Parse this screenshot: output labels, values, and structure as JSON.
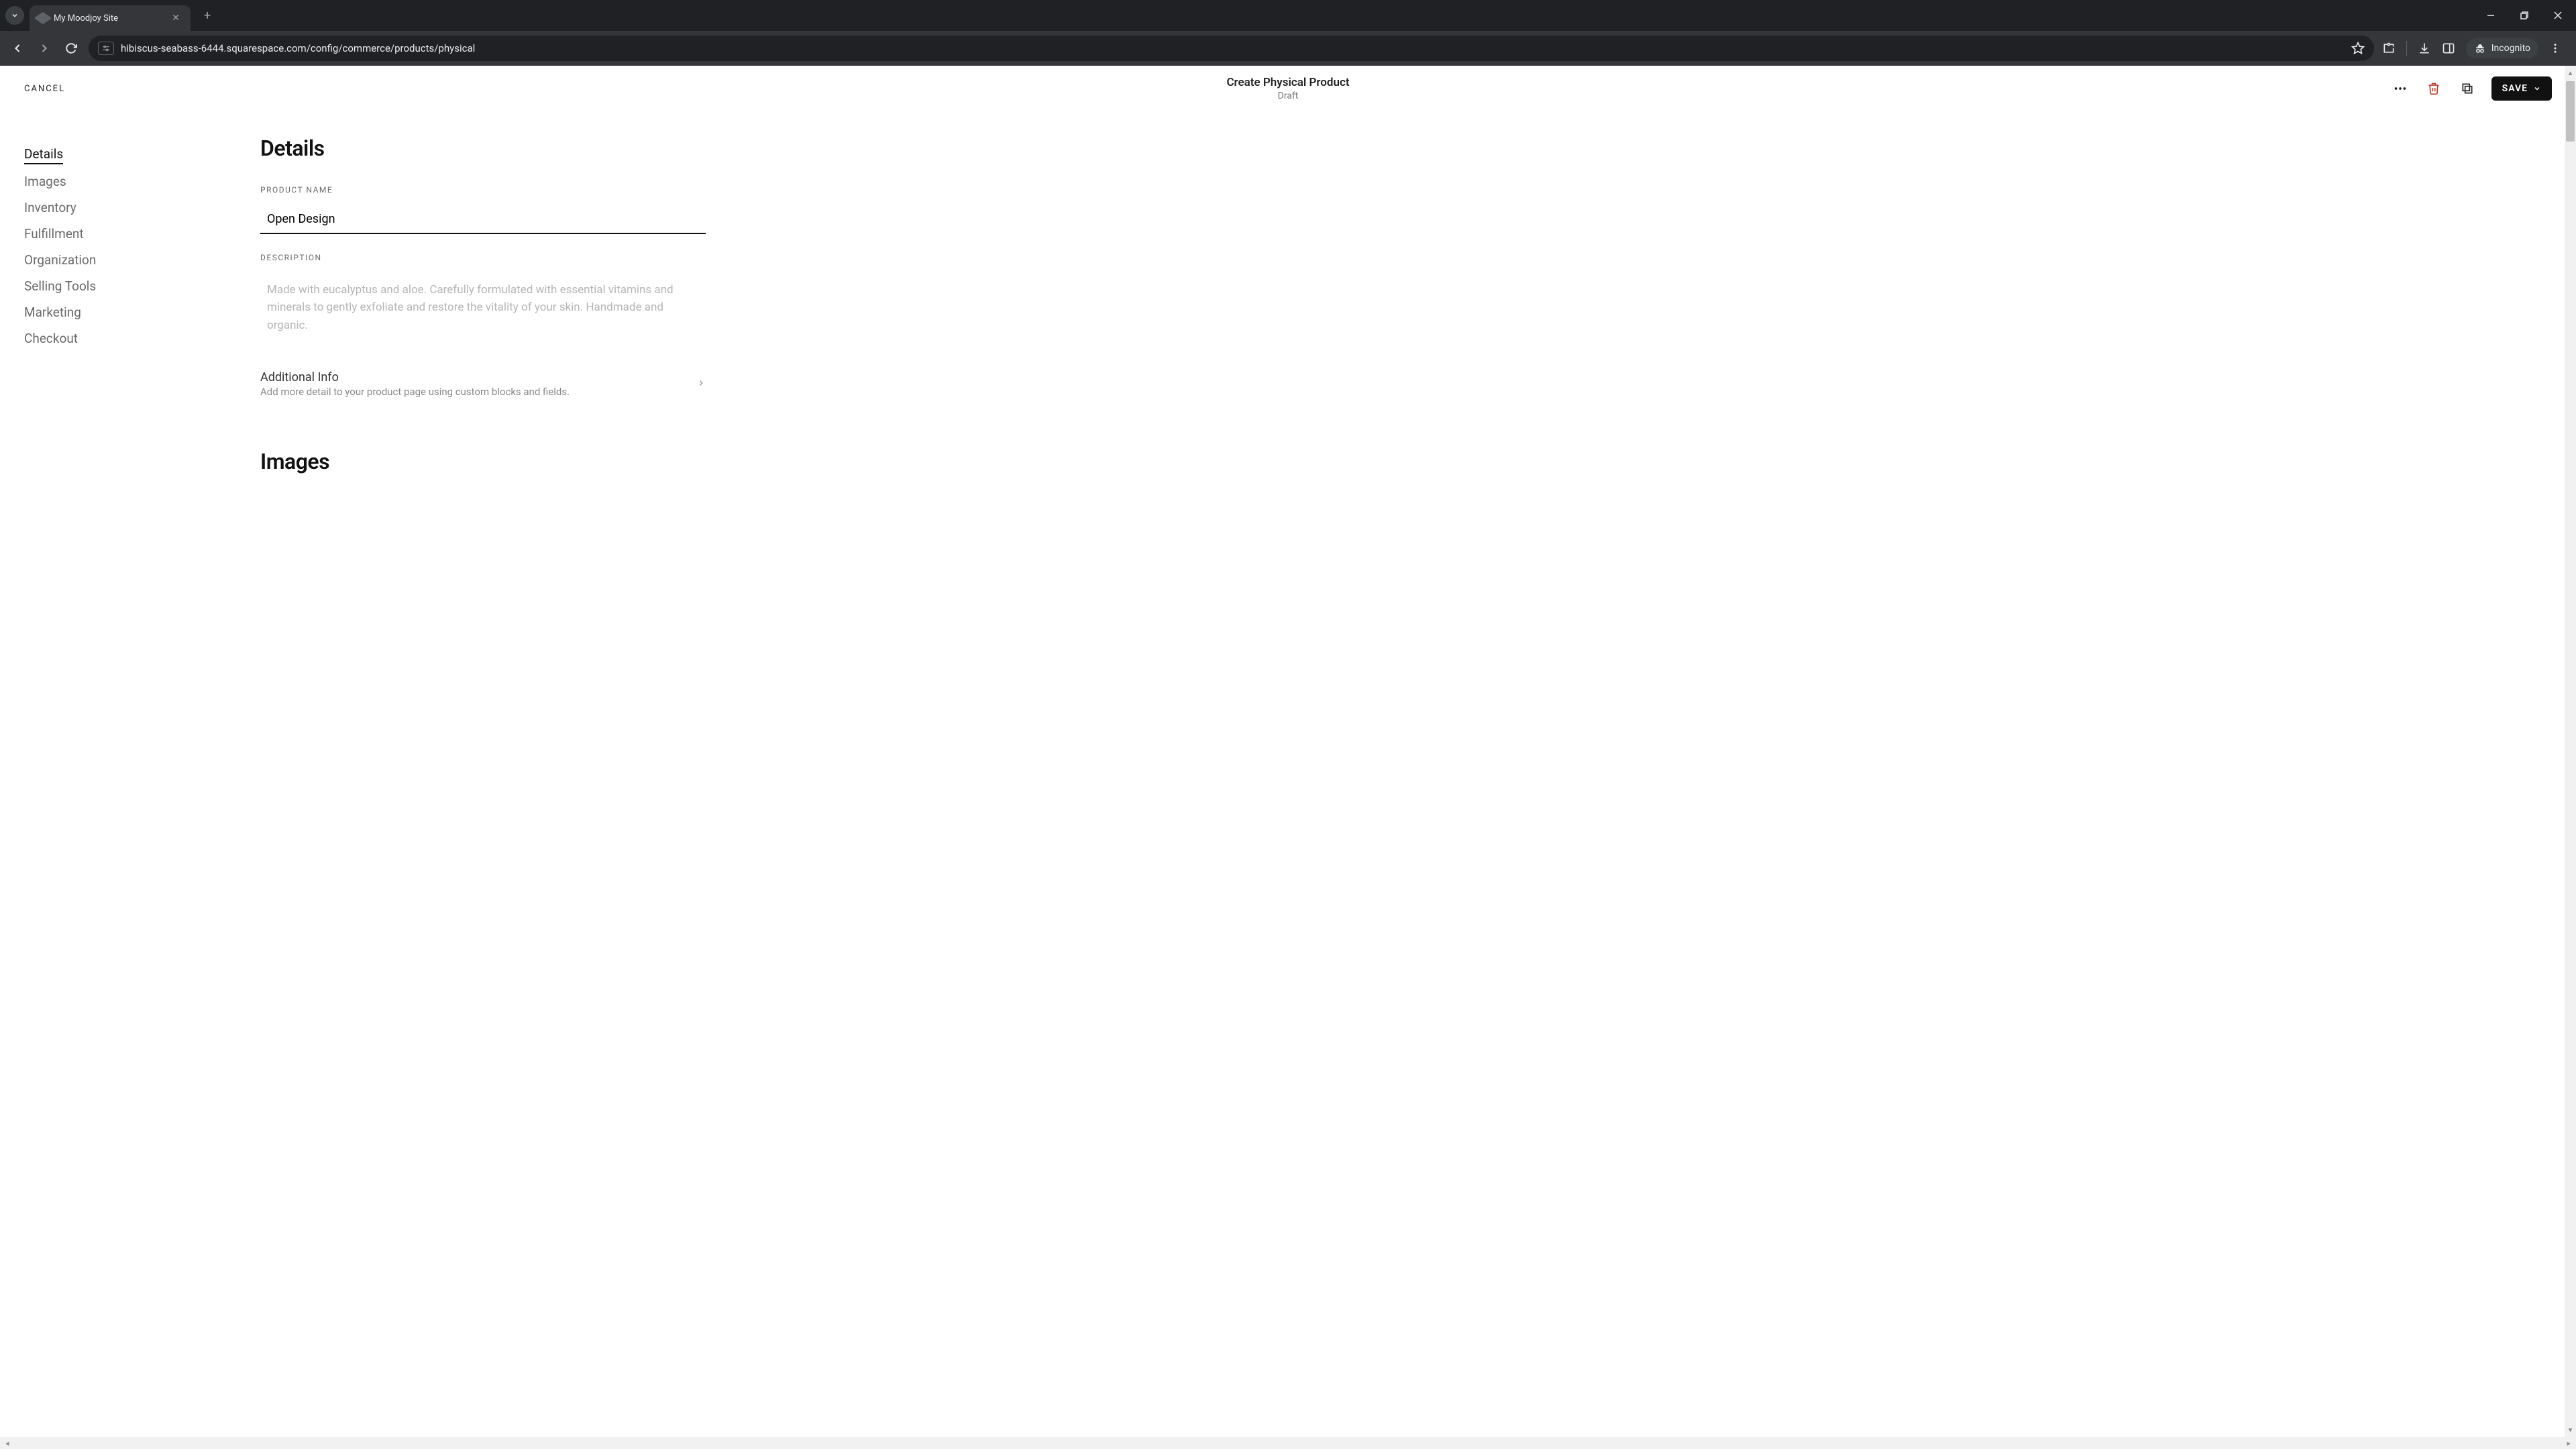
{
  "browser": {
    "tab_title": "My Moodjoy Site",
    "url": "hibiscus-seabass-6444.squarespace.com/config/commerce/products/physical",
    "incognito_label": "Incognito"
  },
  "topbar": {
    "cancel": "CANCEL",
    "title": "Create Physical Product",
    "subtitle": "Draft",
    "save": "SAVE"
  },
  "sidebar": {
    "items": [
      "Details",
      "Images",
      "Inventory",
      "Fulfillment",
      "Organization",
      "Selling Tools",
      "Marketing",
      "Checkout"
    ]
  },
  "details": {
    "heading": "Details",
    "product_name_label": "PRODUCT NAME",
    "product_name_value": "Open Design",
    "description_label": "DESCRIPTION",
    "description_placeholder": "Made with eucalyptus and aloe. Carefully formulated with essential vitamins and minerals to gently exfoliate and restore the vitality of your skin. Handmade and organic.",
    "additional_info_title": "Additional Info",
    "additional_info_sub": "Add more detail to your product page using custom blocks and fields."
  },
  "images": {
    "heading": "Images"
  }
}
